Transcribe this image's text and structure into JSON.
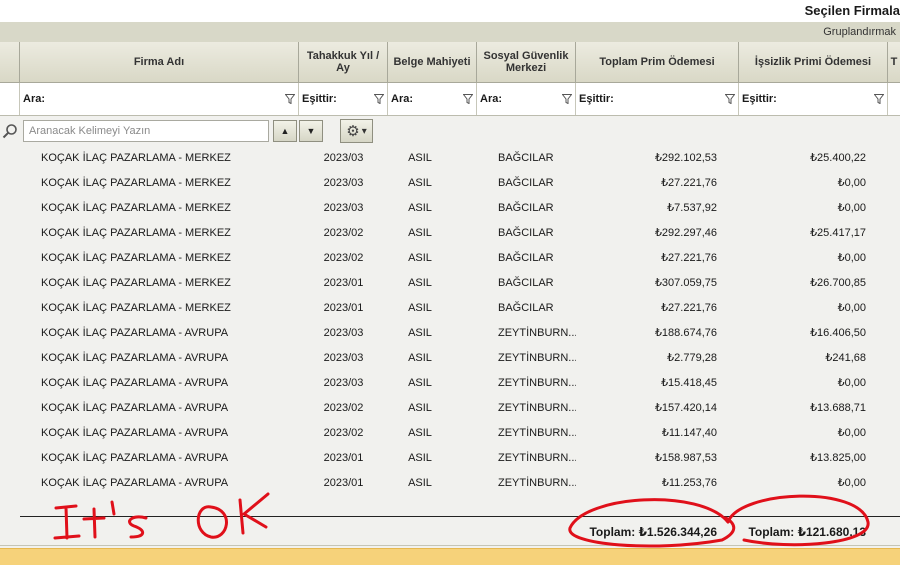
{
  "window": {
    "title": "Seçilen Firmala"
  },
  "grouping": {
    "label": "Gruplandırmak"
  },
  "columns": [
    {
      "id": "firma",
      "label": "Firma Adı"
    },
    {
      "id": "donem",
      "label": "Tahakkuk Yıl / Ay"
    },
    {
      "id": "mahiyet",
      "label": "Belge Mahiyeti"
    },
    {
      "id": "merkez",
      "label": "Sosyal Güvenlik Merkezi"
    },
    {
      "id": "prim",
      "label": "Toplam Prim Ödemesi"
    },
    {
      "id": "issizlik",
      "label": "İşsizlik Primi Ödemesi"
    },
    {
      "id": "next",
      "label": "T"
    }
  ],
  "filters": [
    "Ara:",
    "Eşittir:",
    "Ara:",
    "Ara:",
    "Eşittir:",
    "Eşittir:"
  ],
  "search": {
    "placeholder": "Aranacak Kelimeyi Yazın",
    "up_glyph": "▲",
    "down_glyph": "▼",
    "gear_glyph": "⚙",
    "dropdown_glyph": "▾"
  },
  "rows": [
    [
      "KOÇAK İLAÇ PAZARLAMA - MERKEZ",
      "2023/03",
      "ASIL",
      "BAĞCILAR",
      "₺292.102,53",
      "₺25.400,22"
    ],
    [
      "KOÇAK İLAÇ PAZARLAMA - MERKEZ",
      "2023/03",
      "ASIL",
      "BAĞCILAR",
      "₺27.221,76",
      "₺0,00"
    ],
    [
      "KOÇAK İLAÇ PAZARLAMA - MERKEZ",
      "2023/03",
      "ASIL",
      "BAĞCILAR",
      "₺7.537,92",
      "₺0,00"
    ],
    [
      "KOÇAK İLAÇ PAZARLAMA - MERKEZ",
      "2023/02",
      "ASIL",
      "BAĞCILAR",
      "₺292.297,46",
      "₺25.417,17"
    ],
    [
      "KOÇAK İLAÇ PAZARLAMA - MERKEZ",
      "2023/02",
      "ASIL",
      "BAĞCILAR",
      "₺27.221,76",
      "₺0,00"
    ],
    [
      "KOÇAK İLAÇ PAZARLAMA - MERKEZ",
      "2023/01",
      "ASIL",
      "BAĞCILAR",
      "₺307.059,75",
      "₺26.700,85"
    ],
    [
      "KOÇAK İLAÇ PAZARLAMA - MERKEZ",
      "2023/01",
      "ASIL",
      "BAĞCILAR",
      "₺27.221,76",
      "₺0,00"
    ],
    [
      "KOÇAK İLAÇ PAZARLAMA - AVRUPA",
      "2023/03",
      "ASIL",
      "ZEYTİNBURN...",
      "₺188.674,76",
      "₺16.406,50"
    ],
    [
      "KOÇAK İLAÇ PAZARLAMA - AVRUPA",
      "2023/03",
      "ASIL",
      "ZEYTİNBURN...",
      "₺2.779,28",
      "₺241,68"
    ],
    [
      "KOÇAK İLAÇ PAZARLAMA - AVRUPA",
      "2023/03",
      "ASIL",
      "ZEYTİNBURN...",
      "₺15.418,45",
      "₺0,00"
    ],
    [
      "KOÇAK İLAÇ PAZARLAMA - AVRUPA",
      "2023/02",
      "ASIL",
      "ZEYTİNBURN...",
      "₺157.420,14",
      "₺13.688,71"
    ],
    [
      "KOÇAK İLAÇ PAZARLAMA - AVRUPA",
      "2023/02",
      "ASIL",
      "ZEYTİNBURN...",
      "₺11.147,40",
      "₺0,00"
    ],
    [
      "KOÇAK İLAÇ PAZARLAMA - AVRUPA",
      "2023/01",
      "ASIL",
      "ZEYTİNBURN...",
      "₺158.987,53",
      "₺13.825,00"
    ],
    [
      "KOÇAK İLAÇ PAZARLAMA - AVRUPA",
      "2023/01",
      "ASIL",
      "ZEYTİNBURN...",
      "₺11.253,76",
      "₺0,00"
    ]
  ],
  "totals": {
    "prim": "Toplam: ₺1.526.344,26",
    "issizlik": "Toplam: ₺121.680,13"
  },
  "annotation": {
    "text": "It's OK",
    "color": "#e0101a"
  },
  "colors": {
    "header_bg": "#d9d8c6",
    "bottom_strip": "#f6d27a"
  }
}
